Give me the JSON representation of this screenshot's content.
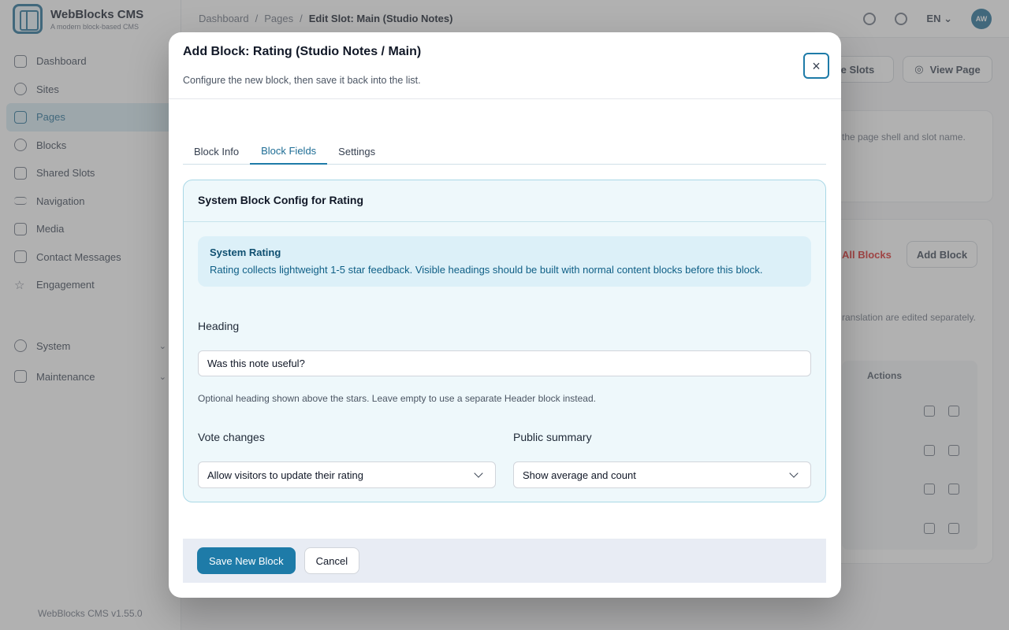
{
  "app": {
    "name": "WebBlocks CMS",
    "tagline": "A modern block-based CMS",
    "version": "WebBlocks CMS v1.55.0"
  },
  "sidebar": {
    "items": [
      {
        "label": "Dashboard",
        "icon": "dashboard-icon"
      },
      {
        "label": "Sites",
        "icon": "globe-icon"
      },
      {
        "label": "Pages",
        "icon": "page-icon",
        "active": true
      },
      {
        "label": "Blocks",
        "icon": "blocks-icon"
      },
      {
        "label": "Shared Slots",
        "icon": "layers-icon"
      },
      {
        "label": "Navigation",
        "icon": "menu-icon"
      },
      {
        "label": "Media",
        "icon": "image-icon"
      },
      {
        "label": "Contact Messages",
        "icon": "mail-icon"
      },
      {
        "label": "Engagement",
        "icon": "star-icon"
      }
    ],
    "groups": [
      {
        "label": "System",
        "icon": "gear-icon"
      },
      {
        "label": "Maintenance",
        "icon": "wrench-icon"
      }
    ]
  },
  "topbar": {
    "breadcrumb": [
      "Dashboard",
      "Pages"
    ],
    "current": "Edit Slot: Main (Studio Notes)",
    "lang": "EN",
    "avatar_initials": "AW"
  },
  "background": {
    "btn_page_slots": "Page Slots",
    "btn_view_page": "View Page",
    "hint_text": "the page shell and slot name.",
    "link_all_blocks": "All Blocks",
    "btn_add_block": "Add Block",
    "note_text": "ranslation are edited separately.",
    "col_actions": "Actions"
  },
  "modal": {
    "title": "Add Block: Rating (Studio Notes / Main)",
    "subtitle": "Configure the new block, then save it back into the list.",
    "close_symbol": "×",
    "tabs": [
      {
        "label": "Block Info",
        "active": false
      },
      {
        "label": "Block Fields",
        "active": true
      },
      {
        "label": "Settings",
        "active": false
      }
    ],
    "config": {
      "title": "System Block Config for Rating",
      "info_title": "System Rating",
      "info_text": "Rating collects lightweight 1-5 star feedback. Visible headings should be built with normal content blocks before this block.",
      "heading_label": "Heading",
      "heading_value": "Was this note useful?",
      "heading_help": "Optional heading shown above the stars. Leave empty to use a separate Header block instead.",
      "vote_label": "Vote changes",
      "vote_value": "Allow visitors to update their rating",
      "summary_label": "Public summary",
      "summary_value": "Show average and count"
    },
    "footer": {
      "save_label": "Save New Block",
      "cancel_label": "Cancel"
    }
  },
  "colors": {
    "accent": "#1e7ba8",
    "card_bg": "#eef8fb",
    "info_bg": "#dcf0f8"
  }
}
